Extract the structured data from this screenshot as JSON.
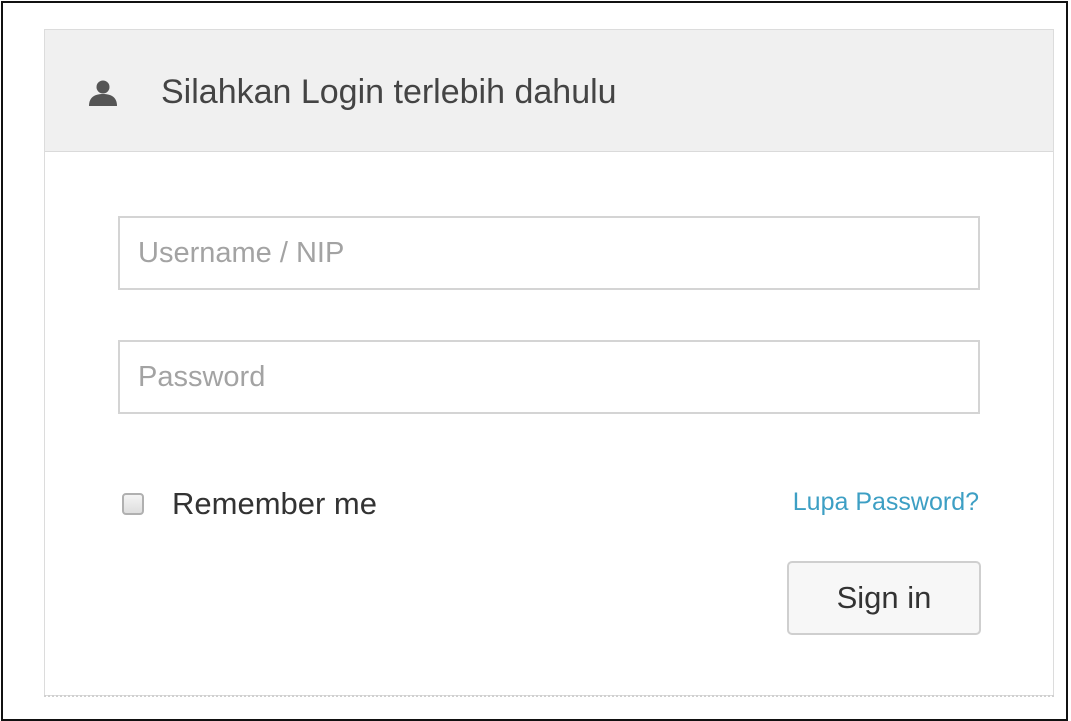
{
  "panel": {
    "heading_icon": "user-icon",
    "heading_title": "Silahkan Login terlebih dahulu"
  },
  "form": {
    "username": {
      "placeholder": "Username / NIP",
      "value": ""
    },
    "password": {
      "placeholder": "Password",
      "value": ""
    },
    "remember_me": {
      "label": "Remember me",
      "checked": false
    },
    "forgot_password_link": "Lupa Password?",
    "submit_label": "Sign in"
  },
  "colors": {
    "link": "#3d9fc4",
    "heading_background": "#f0f0f0",
    "heading_text": "#444444"
  }
}
